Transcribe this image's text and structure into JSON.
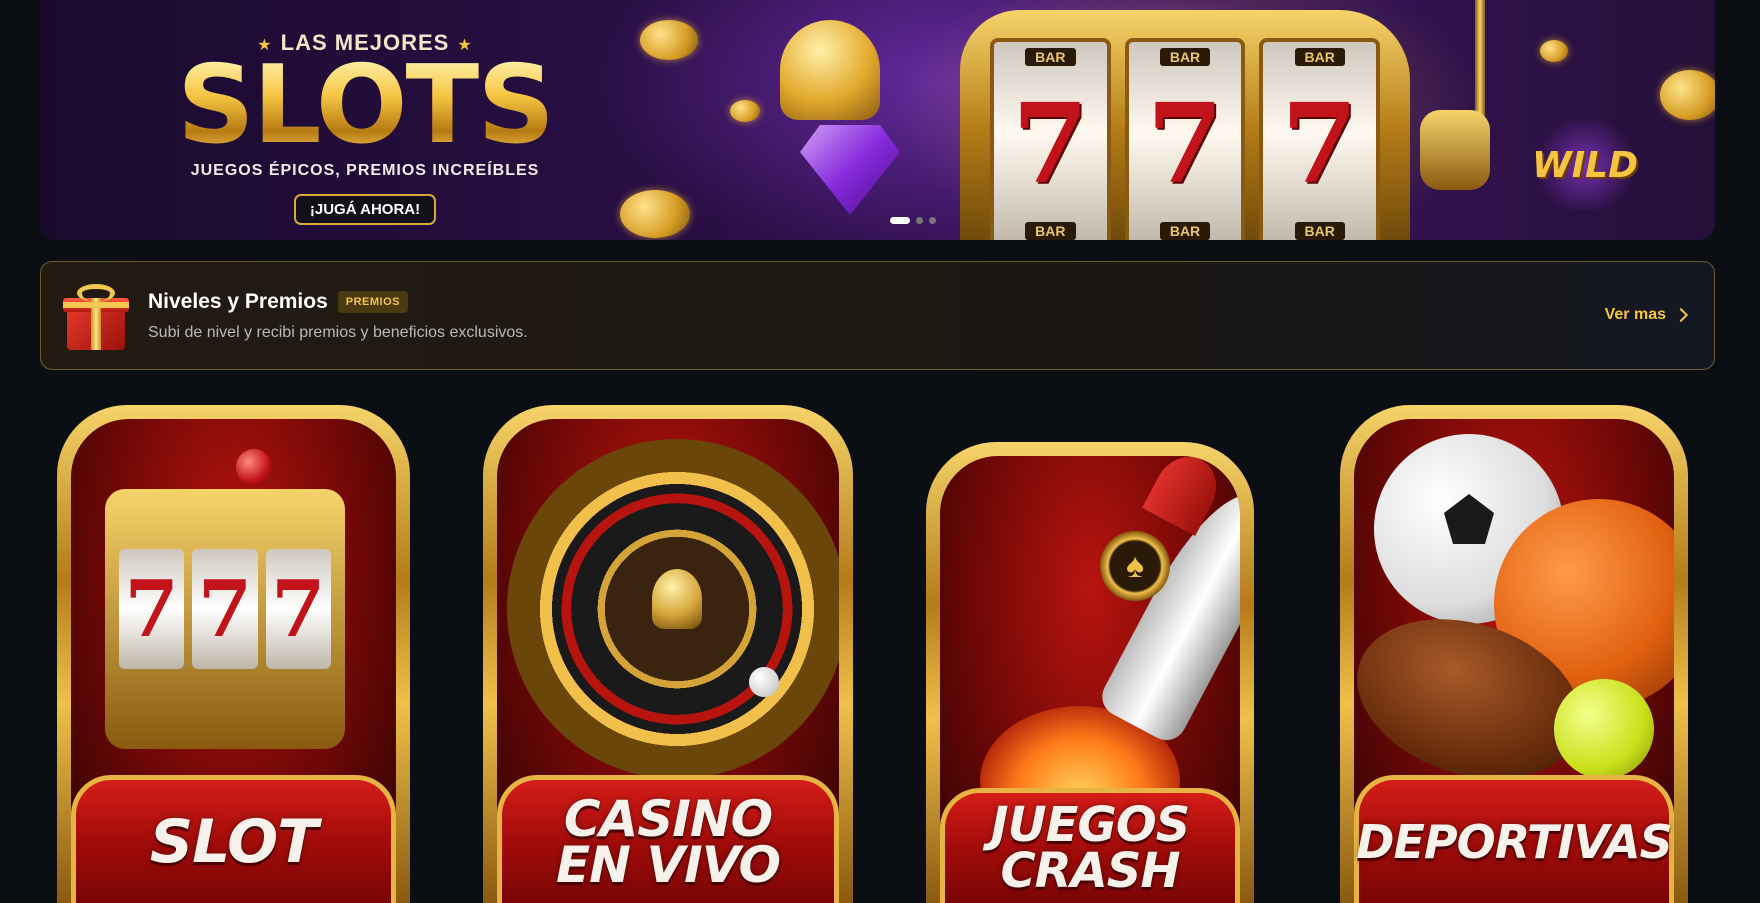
{
  "banner": {
    "kicker": "LAS MEJORES",
    "title": "SLOTS",
    "subtitle": "JUEGOS ÉPICOS, PREMIOS INCREÍBLES",
    "cta": "¡JUGÁ AHORA!",
    "reel_top": [
      "BAR",
      "BAR",
      "BAR"
    ],
    "reel_symbol": [
      "7",
      "7",
      "7"
    ],
    "reel_bottom": [
      "BAR",
      "BAR",
      "BAR"
    ],
    "wild": "WILD",
    "slide_count": 3,
    "active_slide": 1
  },
  "promo": {
    "title": "Niveles y Premios",
    "badge": "PREMIOS",
    "description": "Subi de nivel y recibi premios y beneficios exclusivos.",
    "link": "Ver mas"
  },
  "categories": [
    {
      "label": "SLOT"
    },
    {
      "label": "CASINO\nEN VIVO"
    },
    {
      "label": "JUEGOS\nCRASH"
    },
    {
      "label": "DEPORTIVAS"
    }
  ],
  "colors": {
    "background": "#0b0f14",
    "gold": "#f5c542",
    "red": "#c2121a",
    "promo_border": "#6b5a2c"
  },
  "icons": {
    "promo": "gift-icon",
    "link": "chevron-right-icon",
    "rocket_window": "spade-icon"
  }
}
